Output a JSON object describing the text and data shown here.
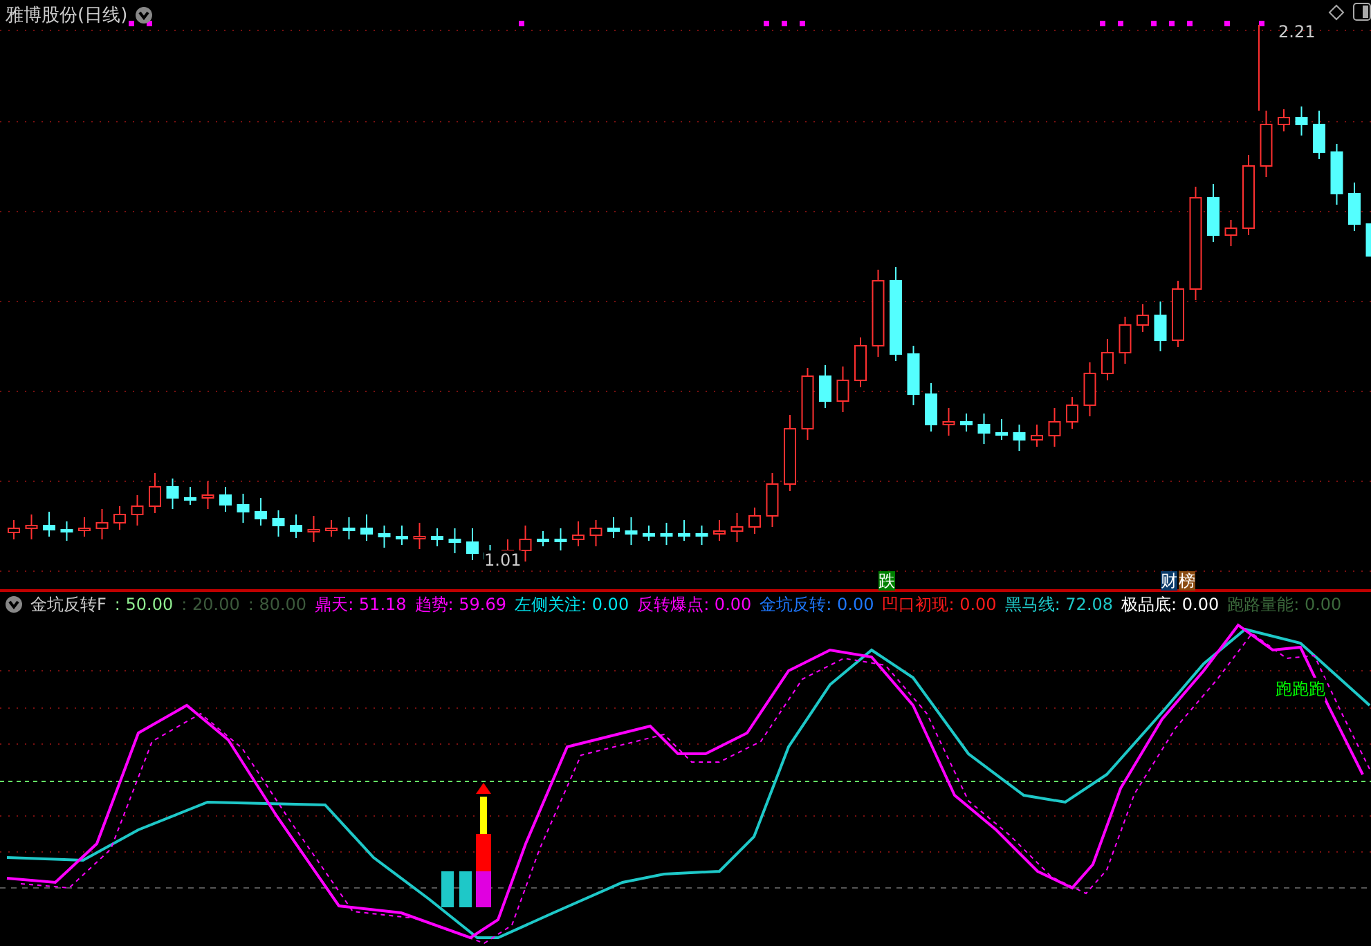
{
  "chart": {
    "title": "雅博股份(日线)",
    "high_label": "2.21",
    "low_label": "1.01",
    "markers": [
      {
        "text": "跌",
        "color": "#008000"
      },
      {
        "text": "财",
        "color": "#0a3a6a"
      },
      {
        "text": "榜",
        "color": "#8a4a10"
      }
    ]
  },
  "indicator": {
    "name": "金坑反转F",
    "params": [
      {
        "value": ": 50.00",
        "color": "#90ee90"
      },
      {
        "value": ": 20.00",
        "color": "#3c5a3c"
      },
      {
        "value": ": 80.00",
        "color": "#3c5a3c"
      }
    ],
    "values": [
      {
        "label": "鼎天:",
        "value": "51.18",
        "color": "#ff00ff"
      },
      {
        "label": "趋势:",
        "value": "59.69",
        "color": "#ff00ff"
      },
      {
        "label": "左侧关注:",
        "value": "0.00",
        "color": "#00e5ee"
      },
      {
        "label": "反转爆点:",
        "value": "0.00",
        "color": "#ff00ff"
      },
      {
        "label": "金坑反转:",
        "value": "0.00",
        "color": "#1e78ff"
      },
      {
        "label": "凹口初现:",
        "value": "0.00",
        "color": "#ff1a1a"
      },
      {
        "label": "黑马线:",
        "value": "72.08",
        "color": "#1ec8c8"
      },
      {
        "label": "极品底:",
        "value": "0.00",
        "color": "#ffffff"
      },
      {
        "label": "跑路量能:",
        "value": "0.00",
        "color": "#3c6a3c"
      }
    ],
    "signal_label": "跑跑跑"
  }
}
